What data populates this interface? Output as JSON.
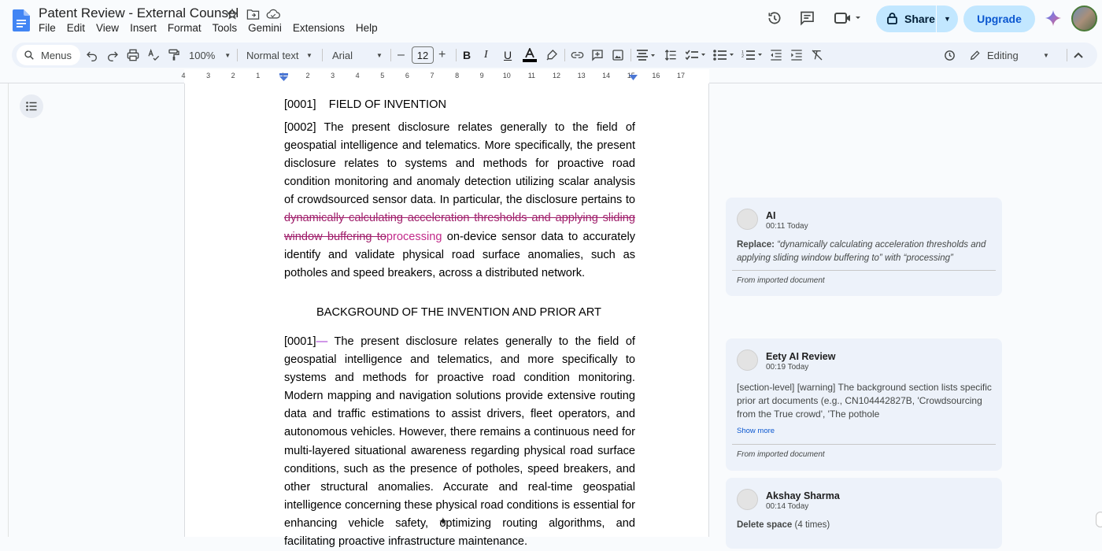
{
  "window": {
    "title": "Patent Review - External Counsel"
  },
  "menubar": [
    "File",
    "Edit",
    "View",
    "Insert",
    "Format",
    "Tools",
    "Gemini",
    "Extensions",
    "Help"
  ],
  "header": {
    "share_label": "Share",
    "upgrade_label": "Upgrade"
  },
  "toolbar": {
    "menus_placeholder": "Menus",
    "zoom": "100%",
    "style": "Normal text",
    "font": "Arial",
    "font_size": "12",
    "mode": "Editing"
  },
  "ruler": {
    "labels": [
      "4",
      "3",
      "2",
      "1",
      "1",
      "2",
      "3",
      "4",
      "5",
      "6",
      "7",
      "8",
      "9",
      "10",
      "11",
      "12",
      "13",
      "14",
      "15",
      "16",
      "17"
    ]
  },
  "document": {
    "heading1": "[0001]    FIELD OF INVENTION",
    "p2_part1": "[0002]    The present disclosure relates generally to the field of geospatial intelligence and telematics. More specifically, the present disclosure relates to systems and methods for proactive road condition monitoring and anomaly detection utilizing scalar analysis of crowdsourced sensor data. In particular, the disclosure pertains to ",
    "p2_deleted": "dynamically calculating acceleration thresholds and applying sliding window buffering to",
    "p2_inserted": "processing",
    "p2_part2": " on-device sensor data to accurately identify and validate physical road surface anomalies, such as potholes and speed breakers, across a distributed network.",
    "bg_title": "BACKGROUND OF THE INVENTION AND PRIOR ART",
    "p3_number": "[0001]",
    "p3_marker": "—",
    "p3_text": " The present disclosure relates generally to the field of geospatial intelligence and telematics, and more specifically to systems and methods for proactive road condition monitoring. Modern mapping and navigation solutions provide extensive routing data and traffic estimations to assist drivers, fleet operators, and autonomous vehicles. However, there remains a continuous need for multi-layered situational awareness regarding physical road surface conditions, such as the presence of potholes, speed breakers, and other structural anomalies. Accurate and real-time geospatial intelligence concerning these physical road conditions is essential for enhancing vehicle safety, optimizing routing algorithms, and facilitating proactive infrastructure maintenance."
  },
  "comments": [
    {
      "author": "AI",
      "time": "00:11 Today",
      "action": "Replace:",
      "body": " “dynamically calculating acceleration thresholds and applying sliding window buffering to” with “processing”",
      "footer": "From imported document"
    },
    {
      "author": "Eety AI Review",
      "time": "00:19 Today",
      "body": "[section-level] [warning] The background section lists specific prior art documents (e.g., CN104442827B, 'Crowdsourcing from the True crowd', 'The pothole",
      "show_more": "Show more",
      "footer": "From imported document"
    },
    {
      "author": "Akshay Sharma",
      "time": "00:14 Today",
      "action": "Delete space",
      "body": " (4 times)"
    }
  ]
}
